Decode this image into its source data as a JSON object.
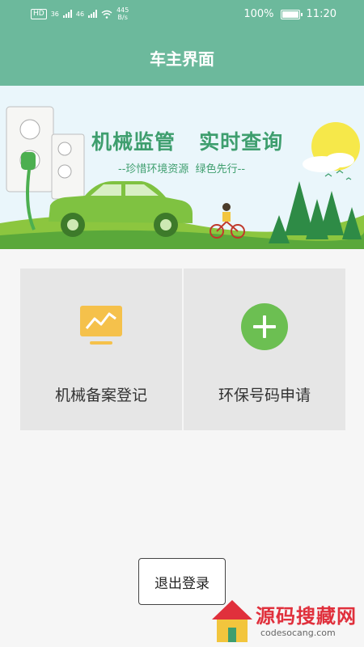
{
  "status_bar": {
    "hd": "HD",
    "net1": "36",
    "net2": "46",
    "speed_value": "445",
    "speed_unit": "B/s",
    "battery": "100%",
    "time": "11:20"
  },
  "app_bar": {
    "title": "车主界面"
  },
  "banner": {
    "title": "机械监管   实时查询",
    "subtitle": "--珍惜环境资源  绿色先行--"
  },
  "tiles": [
    {
      "label": "机械备案登记",
      "icon": "chart-monitor-icon",
      "color": "#f5c14b"
    },
    {
      "label": "环保号码申请",
      "icon": "plus-circle-icon",
      "color": "#6cbf52"
    }
  ],
  "logout_label": "退出登录",
  "watermark": {
    "text": "源码搜藏网",
    "url": "codesocang.com"
  },
  "colors": {
    "primary": "#6cb99c",
    "tile_bg": "#e6e6e6",
    "page_bg": "#f6f6f6"
  }
}
